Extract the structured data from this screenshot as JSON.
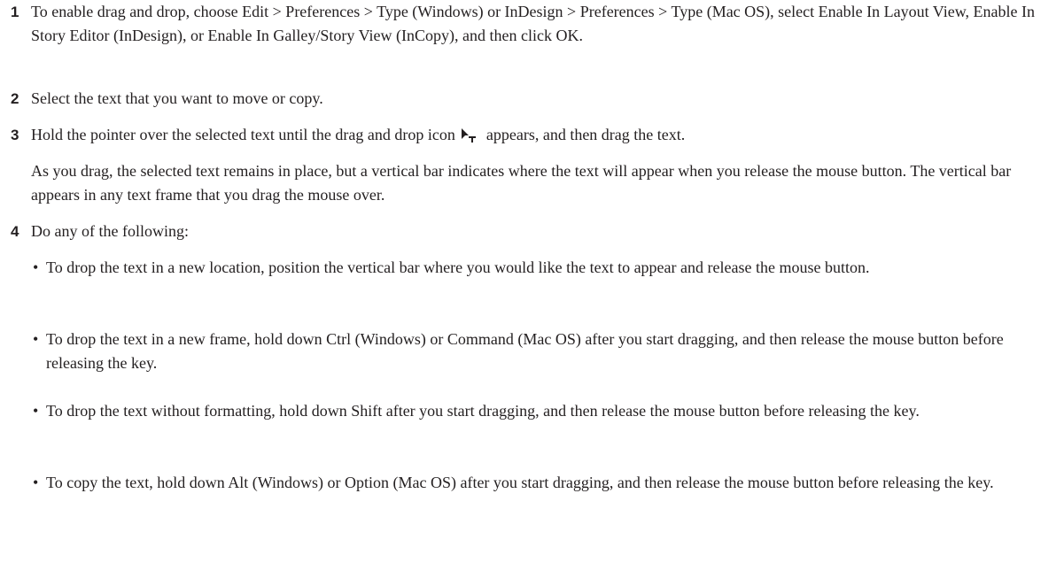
{
  "steps": [
    {
      "num": "1",
      "text": "To enable drag and drop, choose Edit > Preferences > Type (Windows) or InDesign > Preferences > Type (Mac OS), select Enable In Layout View, Enable In Story Editor (InDesign), or Enable In Galley/Story View (InCopy), and then click OK."
    },
    {
      "num": "2",
      "text": "Select the text that you want to move or copy."
    },
    {
      "num": "3",
      "text_before_icon": "Hold the pointer over the selected text until the drag and drop icon",
      "text_after_icon": "appears, and then drag the text.",
      "icon": "drag-and-drop-icon"
    },
    {
      "num": "4",
      "text": "Do any of the following:"
    }
  ],
  "note": "As you drag, the selected text remains in place, but a vertical bar indicates where the text will appear when you release the mouse button. The vertical bar appears in any text frame that you drag the mouse over.",
  "bullets": [
    "To drop the text in a new location, position the vertical bar where you would like the text to appear and release the mouse button.",
    "To drop the text in a new frame, hold down Ctrl (Windows) or Command (Mac OS) after you start dragging, and then release the mouse button before releasing the key.",
    "To drop the text without formatting, hold down Shift after you start dragging, and then release the mouse button before releasing the key.",
    "To copy the text, hold down Alt (Windows) or Option (Mac OS) after you start dragging, and then release the mouse button before releasing the key."
  ],
  "bullet_char": "•"
}
